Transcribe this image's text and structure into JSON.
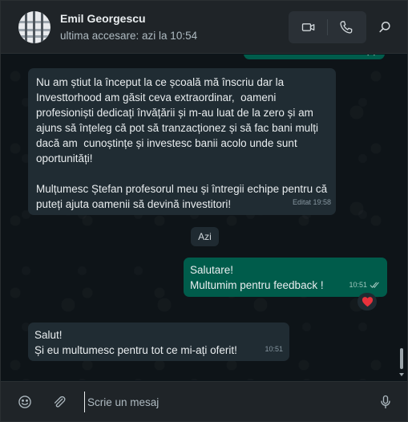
{
  "header": {
    "contact_name": "Emil Georgescu",
    "contact_status": "ultima accesare: azi la 10:54",
    "icons": [
      "video-call-icon",
      "phone-call-icon",
      "search-icon"
    ]
  },
  "messages": [
    {
      "direction": "incoming",
      "paragraph1": "Nu am știut la început la ce școală mă înscriu dar la Investtorhood am găsit ceva extraordinar,  oameni profesioniști dedicați învățării și m-au luat de la zero și am ajuns să înțeleg că pot să tranzacționez și să fac bani mulți dacă am  cunoștințe și investesc banii acolo unde sunt oportunități!",
      "paragraph2": "Mulțumesc Ștefan profesorul meu și întregii echipe pentru că puteți ajuta oamenii să devină investitori!",
      "meta": "Editat 19:58"
    },
    {
      "direction": "outgoing",
      "line1": "Salutare!",
      "line2": "Multumim pentru feedback !",
      "time": "10:51",
      "reaction": "heart"
    },
    {
      "direction": "incoming",
      "line1": "Salut!",
      "line2": "Și eu multumesc pentru tot ce mi-ați oferit!",
      "time": "10:51"
    }
  ],
  "date_separator": "Azi",
  "composer": {
    "placeholder": "Scrie un mesaj",
    "icons": [
      "emoji-icon",
      "attachment-icon",
      "microphone-icon"
    ]
  },
  "colors": {
    "outgoing_bubble": "#005c4b",
    "incoming_bubble": "#202c33",
    "header_bg": "#1f2428",
    "reaction_heart": "#e8323c"
  }
}
